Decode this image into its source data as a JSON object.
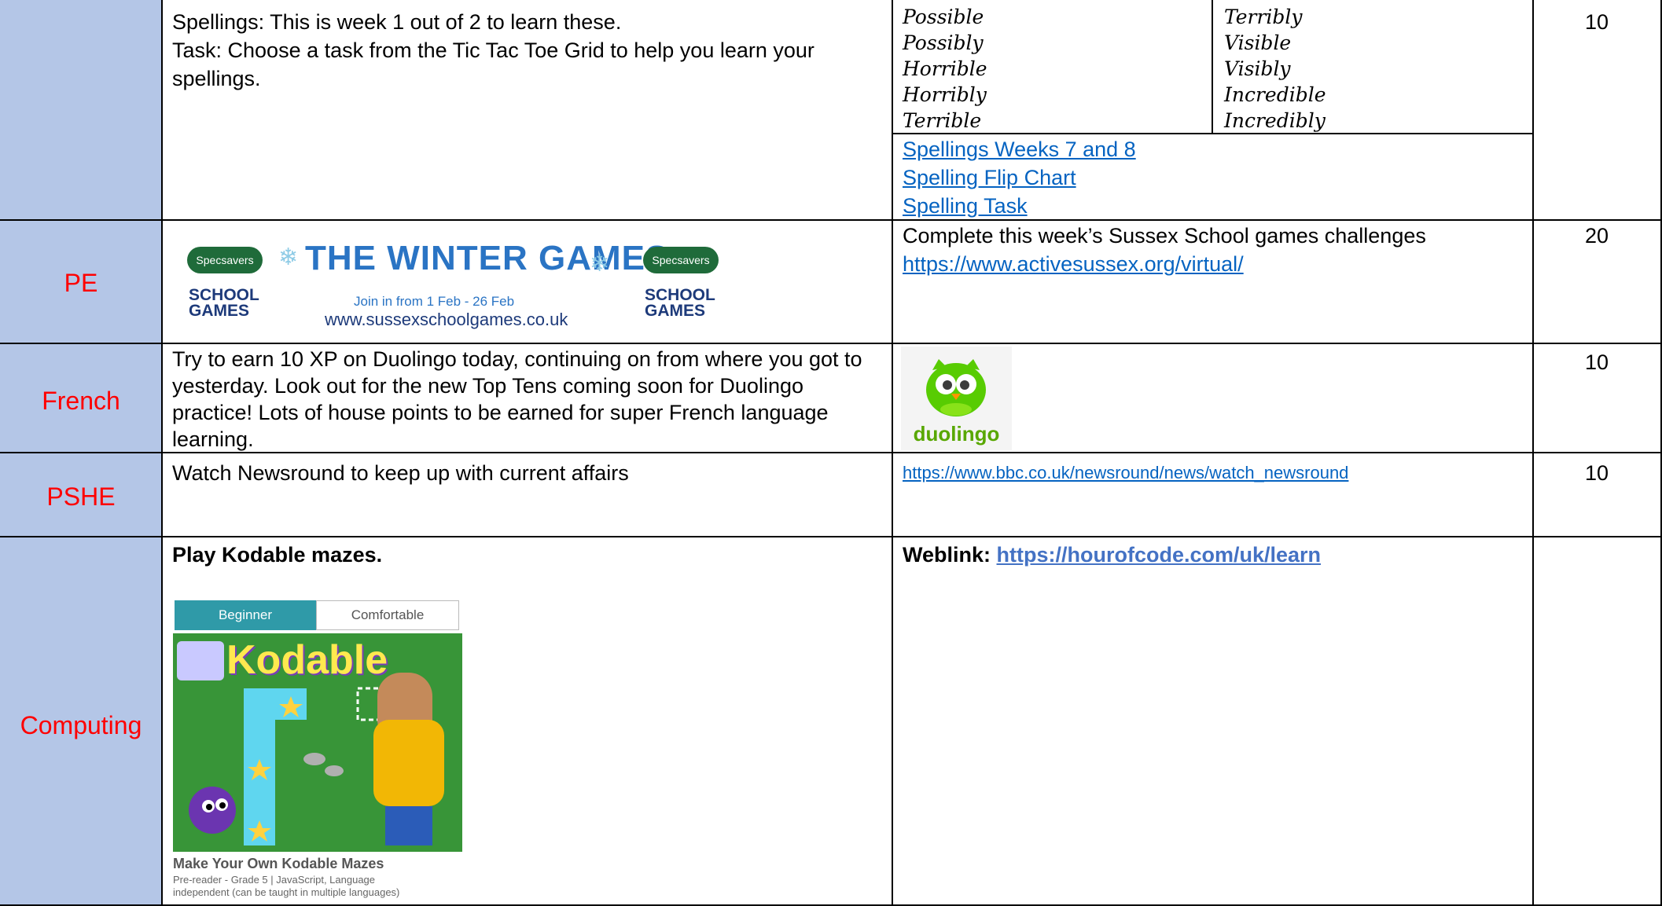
{
  "rows": {
    "spellings": {
      "subject": "",
      "task_line1": "Spellings: This is week 1 out of 2 to learn these.",
      "task_line2": "Task:  Choose a task from the Tic Tac Toe Grid to help you learn your",
      "task_line3": "spellings.",
      "words_left": [
        "Possible",
        "Possibly",
        "Horrible",
        "Horribly",
        "Terrible"
      ],
      "words_right": [
        "Terribly",
        "Visible",
        "Visibly",
        "Incredible",
        "Incredibly"
      ],
      "links": [
        "Spellings Weeks 7 and 8",
        "Spelling Flip Chart",
        "Spelling Task"
      ],
      "points": "10"
    },
    "pe": {
      "subject": "PE",
      "banner": {
        "brand": "Specsavers",
        "title": "THE WINTER GAMES",
        "school_games_line1": "SCHOOL",
        "school_games_line2": "GAMES",
        "dates": "Join in from 1 Feb - 26 Feb",
        "site": "www.sussexschoolgames.co.uk"
      },
      "resource_text": "Complete this week’s Sussex School games challenges",
      "resource_link": "https://www.activesussex.org/virtual/",
      "points": "20"
    },
    "french": {
      "subject": "French",
      "task_lines": [
        "Try to earn 10 XP on Duolingo today, continuing on from where you got to",
        "yesterday. Look out for the new Top Tens coming soon for Duolingo",
        "practice! Lots of house points to be earned for super French language",
        "learning."
      ],
      "logo_text": "duolingo",
      "points": "10"
    },
    "pshe": {
      "subject": "PSHE",
      "task": "Watch Newsround to keep up with current affairs",
      "resource_link": "https://www.bbc.co.uk/newsround/news/watch_newsround",
      "points": "10"
    },
    "computing": {
      "subject": "Computing",
      "task": "Play Kodable mazes.",
      "tabs": [
        "Beginner",
        "Comfortable"
      ],
      "game_logo": "Kodable",
      "card_title": "Make Your Own Kodable Mazes",
      "card_desc_line1": "Pre-reader - Grade 5 | JavaScript, Language",
      "card_desc_line2": "independent (can be taught in multiple languages)",
      "weblink_label": "Weblink: ",
      "weblink_url": "https://hourofcode.com/uk/learn",
      "points": ""
    }
  },
  "colors": {
    "subject_bg": "#b4c6e7",
    "subject_text": "#ff0000",
    "link": "#0563c1",
    "duolingo_green": "#58cc02",
    "kodable_teal": "#2f9aa8"
  }
}
